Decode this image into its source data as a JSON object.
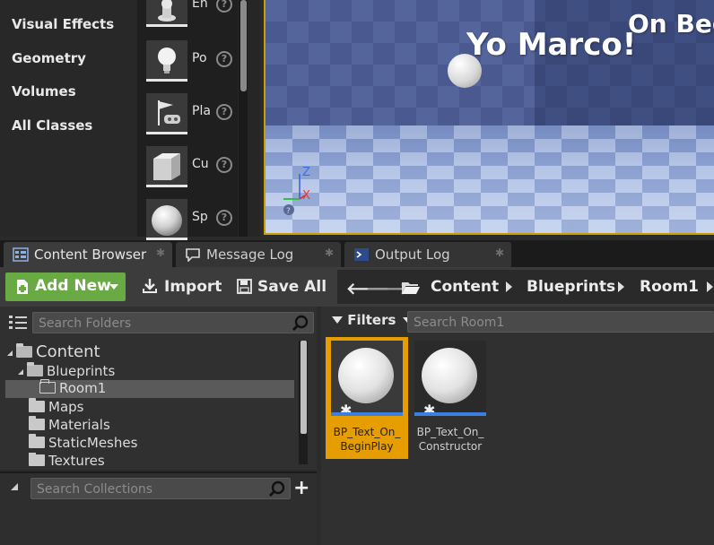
{
  "place_actors": {
    "categories": [
      "Visual Effects",
      "Geometry",
      "Volumes",
      "All Classes"
    ],
    "actors": [
      {
        "label": "En",
        "icon": "pawn-icon"
      },
      {
        "label": "Po",
        "icon": "point-light-icon"
      },
      {
        "label": "Pla",
        "icon": "player-start-icon"
      },
      {
        "label": "Cu",
        "icon": "cube-icon"
      },
      {
        "label": "Sp",
        "icon": "sphere-icon"
      }
    ],
    "help_glyph": "?"
  },
  "viewport": {
    "text_large": "Yo Marco!",
    "text_top": "On Beg",
    "axis_z": "Z",
    "axis_x": "X"
  },
  "tabs": [
    {
      "label": "Content Browser",
      "active": true
    },
    {
      "label": "Message Log",
      "active": false
    },
    {
      "label": "Output Log",
      "active": false
    }
  ],
  "toolbar": {
    "add_new": "Add New",
    "import": "Import",
    "save_all": "Save All"
  },
  "breadcrumb": [
    "Content",
    "Blueprints",
    "Room1"
  ],
  "folders": {
    "search_placeholder": "Search Folders",
    "tree": {
      "content": "Content",
      "blueprints": "Blueprints",
      "room1": "Room1",
      "maps": "Maps",
      "materials": "Materials",
      "static_meshes": "StaticMeshes",
      "textures": "Textures"
    }
  },
  "collections": {
    "search_placeholder": "Search Collections"
  },
  "assets": {
    "filters_label": "Filters",
    "search_placeholder": "Search Room1",
    "items": [
      {
        "name": "BP_Text_On_BeginPlay",
        "line1": "BP_Text_On_",
        "line2": "BeginPlay",
        "selected": true
      },
      {
        "name": "BP_Text_On_Constructor",
        "line1": "BP_Text_On_",
        "line2": "Constructor",
        "selected": false
      }
    ]
  },
  "colors": {
    "add_new_green": "#6aaa44",
    "selection_orange": "#e59d00",
    "asset_bar_blue": "#3d7fe0",
    "viewport_border": "#c8a000"
  }
}
